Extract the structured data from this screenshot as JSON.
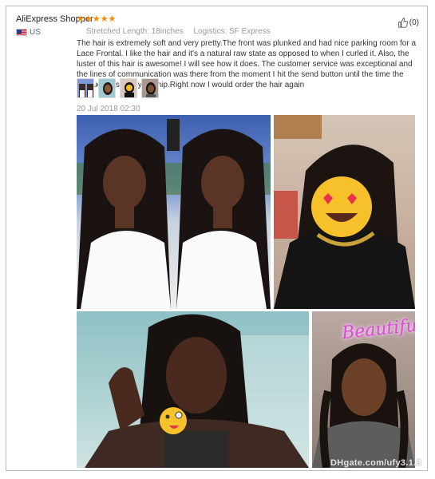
{
  "review": {
    "user": "AliExpress Shopper",
    "stars": "★★★★★",
    "country": "US",
    "helpful_count": "(0)",
    "attributes": [
      {
        "label": "Stretched Length:",
        "value": "18inches"
      },
      {
        "label": "Logistics:",
        "value": "SF Express"
      }
    ],
    "text": "The hair is extremely soft and very pretty.The front was plunked and had nice parking room for a Lace Frontal. I like the hair and it's a natural raw state as opposed to when I curled it. Also, the luster of this hair is awesome! I will see how it does. The customer service was exceptional and the lines of communication was there from the moment I hit the send button until the time the product was ready to ship.Right now I would order the hair again",
    "date": "20 Jul 2018 02:30",
    "thumbnail_count": 4
  },
  "photos": {
    "overlay_text": "Beautiful",
    "emoji_1": "😍",
    "emoji_2": "😜"
  },
  "watermark": "DHgate.com/ufy3.1.3"
}
